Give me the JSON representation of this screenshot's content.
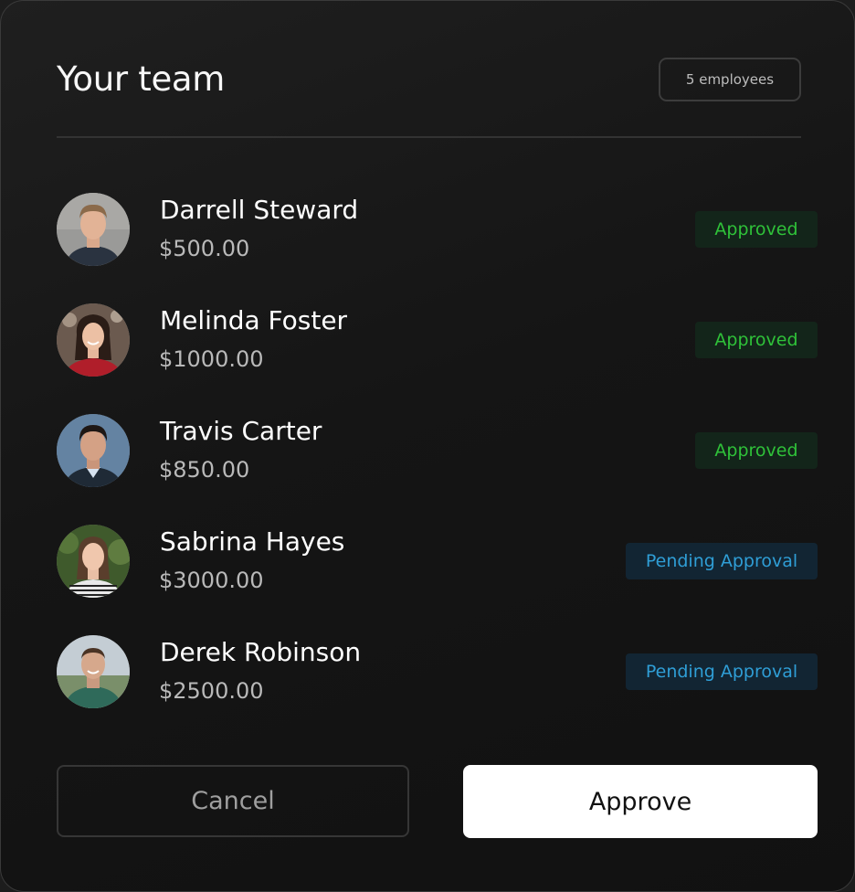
{
  "header": {
    "title": "Your team",
    "employee_count": "5 employees"
  },
  "team": [
    {
      "name": "Darrell Steward",
      "amount": "$500.00",
      "status": "Approved",
      "status_type": "approved",
      "avatar_icon": "person-avatar-icon"
    },
    {
      "name": "Melinda Foster",
      "amount": "$1000.00",
      "status": "Approved",
      "status_type": "approved",
      "avatar_icon": "person-avatar-icon"
    },
    {
      "name": "Travis Carter",
      "amount": "$850.00",
      "status": "Approved",
      "status_type": "approved",
      "avatar_icon": "person-avatar-icon"
    },
    {
      "name": "Sabrina Hayes",
      "amount": "$3000.00",
      "status": "Pending Approval",
      "status_type": "pending",
      "avatar_icon": "person-avatar-icon"
    },
    {
      "name": "Derek Robinson",
      "amount": "$2500.00",
      "status": "Pending Approval",
      "status_type": "pending",
      "avatar_icon": "person-avatar-icon"
    }
  ],
  "actions": {
    "cancel_label": "Cancel",
    "approve_label": "Approve"
  },
  "colors": {
    "approved_text": "#2fc239",
    "approved_bg": "#13251a",
    "pending_text": "#2f9ed6",
    "pending_bg": "#122533"
  }
}
